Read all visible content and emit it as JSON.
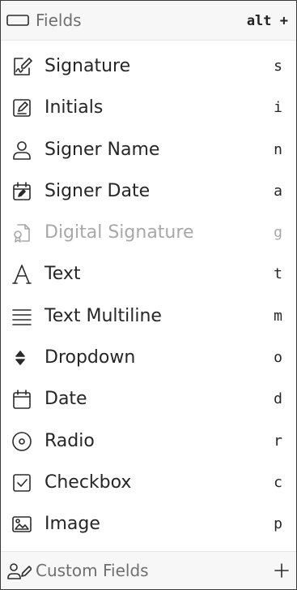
{
  "header": {
    "title": "Fields",
    "shortcut": "alt +"
  },
  "items": [
    {
      "label": "Signature",
      "key": "s",
      "icon": "signature-icon",
      "disabled": false
    },
    {
      "label": "Initials",
      "key": "i",
      "icon": "pencil-icon",
      "disabled": false
    },
    {
      "label": "Signer Name",
      "key": "n",
      "icon": "user-icon",
      "disabled": false
    },
    {
      "label": "Signer Date",
      "key": "a",
      "icon": "calendar-edit-icon",
      "disabled": false
    },
    {
      "label": "Digital Signature",
      "key": "g",
      "icon": "digital-certificate-icon",
      "disabled": true
    },
    {
      "label": "Text",
      "key": "t",
      "icon": "text-a-icon",
      "disabled": false
    },
    {
      "label": "Text Multiline",
      "key": "m",
      "icon": "lines-icon",
      "disabled": false
    },
    {
      "label": "Dropdown",
      "key": "o",
      "icon": "select-arrows-icon",
      "disabled": false
    },
    {
      "label": "Date",
      "key": "d",
      "icon": "calendar-icon",
      "disabled": false
    },
    {
      "label": "Radio",
      "key": "r",
      "icon": "radio-icon",
      "disabled": false
    },
    {
      "label": "Checkbox",
      "key": "c",
      "icon": "checkbox-icon",
      "disabled": false
    },
    {
      "label": "Image",
      "key": "p",
      "icon": "image-icon",
      "disabled": false
    }
  ],
  "footer": {
    "title": "Custom Fields",
    "add_icon": "plus-icon"
  }
}
